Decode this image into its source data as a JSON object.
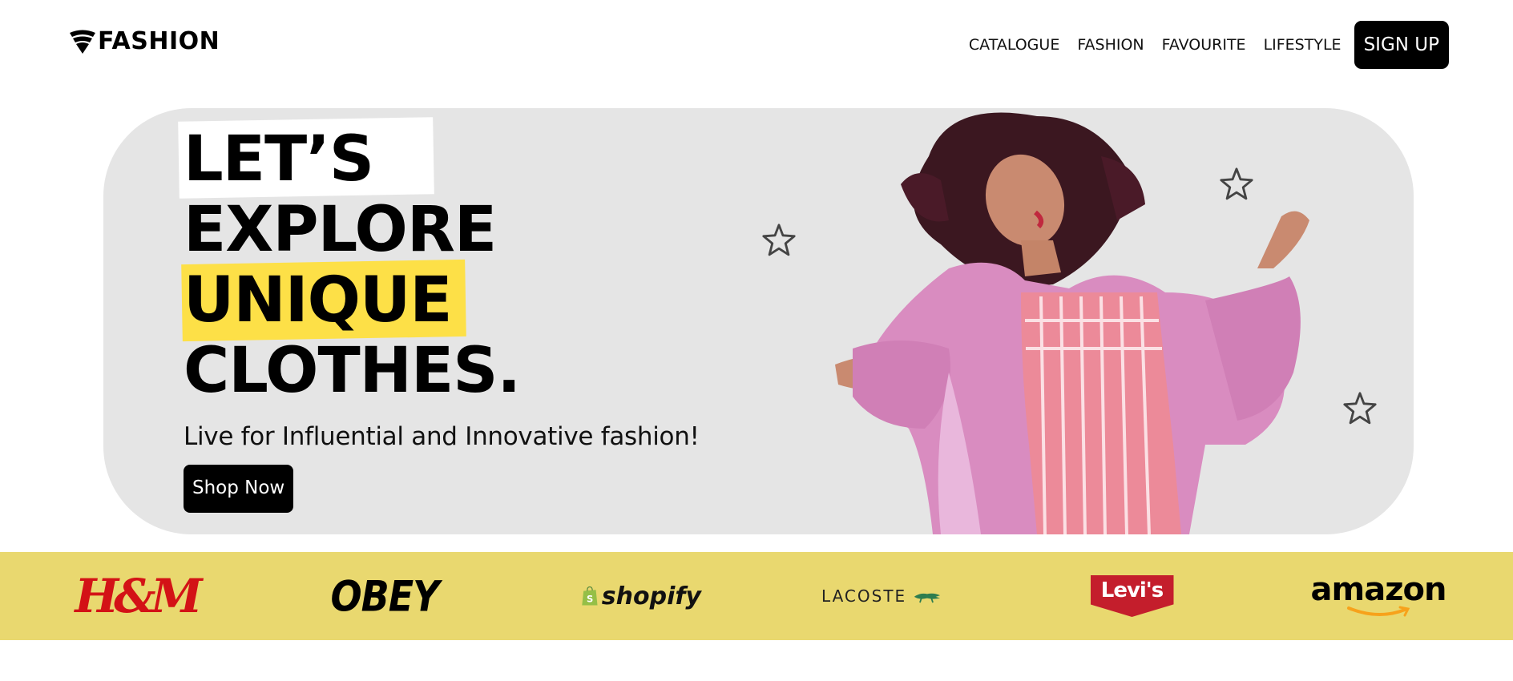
{
  "brand": {
    "name": "FASHION"
  },
  "nav": {
    "links": [
      "CATALOGUE",
      "FASHION",
      "FAVOURITE",
      "LIFESTYLE"
    ],
    "signup_label": "SIGN UP"
  },
  "hero": {
    "headline": [
      "LET’S",
      "EXPLORE",
      "UNIQUE",
      "CLOTHES."
    ],
    "subtitle": "Live for Influential and Innovative fashion!",
    "cta_label": "Shop Now"
  },
  "brands": [
    "H&M",
    "OBEY",
    "shopify",
    "LACOSTE",
    "Levi's",
    "amazon"
  ],
  "colors": {
    "accent_yellow": "#fde047",
    "brand_bar": "#e9d86f",
    "hero_bg": "#e5e5e5",
    "button": "#000000"
  }
}
